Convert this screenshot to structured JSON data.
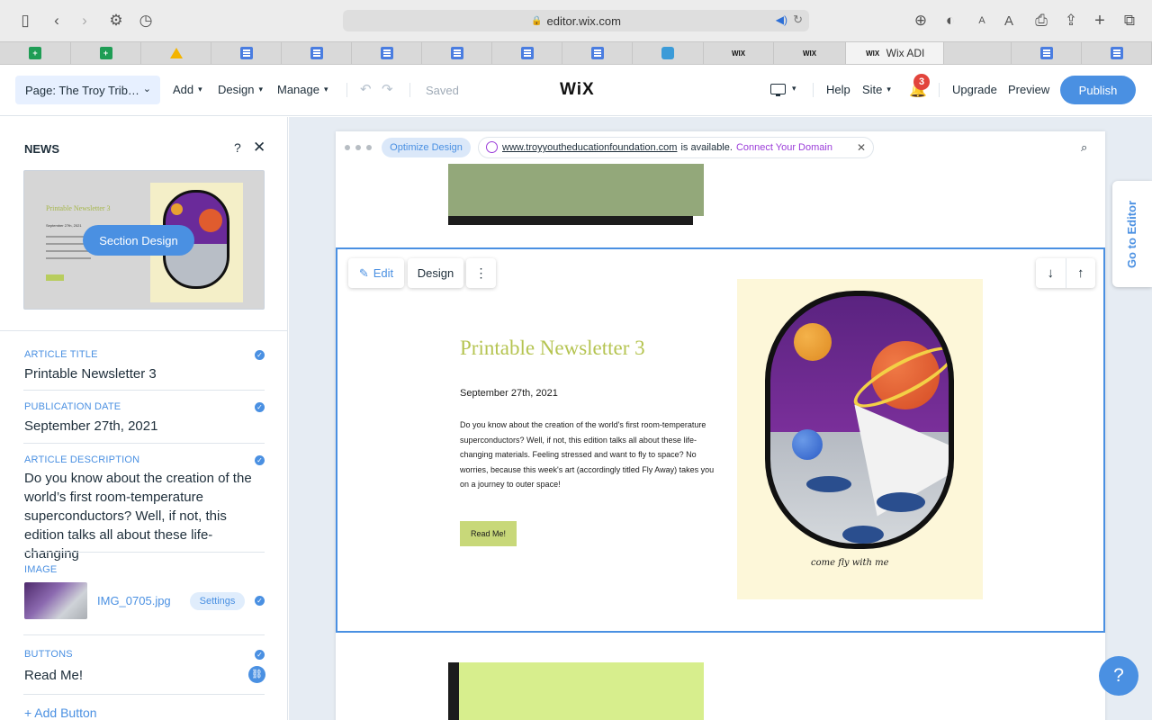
{
  "browser": {
    "url": "editor.wix.com",
    "tabs": [
      {
        "icon": "sheets-icon",
        "label": ""
      },
      {
        "icon": "sheets-icon",
        "label": ""
      },
      {
        "icon": "drive-icon",
        "label": ""
      },
      {
        "icon": "docs-icon",
        "label": ""
      },
      {
        "icon": "docs-icon",
        "label": ""
      },
      {
        "icon": "docs-icon",
        "label": ""
      },
      {
        "icon": "docs-icon",
        "label": ""
      },
      {
        "icon": "docs-icon",
        "label": ""
      },
      {
        "icon": "app-icon",
        "label": ""
      },
      {
        "icon": "wix-icon",
        "label": ""
      },
      {
        "icon": "wix-icon",
        "label": ""
      },
      {
        "icon": "wix-icon",
        "label": "Wix ADI"
      },
      {
        "icon": "docs-icon",
        "label": ""
      },
      {
        "icon": "docs-icon",
        "label": ""
      }
    ]
  },
  "editor": {
    "page_select": "Page: The Troy Trib…",
    "menu": {
      "add": "Add",
      "design": "Design",
      "manage": "Manage"
    },
    "saved": "Saved",
    "logo": "WiX",
    "help": "Help",
    "site": "Site",
    "notifications": "3",
    "upgrade": "Upgrade",
    "preview": "Preview",
    "publish": "Publish"
  },
  "panel": {
    "title": "NEWS",
    "help": "?",
    "section_design": "Section Design",
    "thumb": {
      "title": "Printable Newsletter 3",
      "date": "September 27th, 2021"
    },
    "fields": {
      "article_title_label": "ARTICLE TITLE",
      "article_title": "Printable Newsletter 3",
      "publication_date_label": "PUBLICATION DATE",
      "publication_date": "September 27th, 2021",
      "article_description_label": "ARTICLE DESCRIPTION",
      "article_description": "Do you know about the creation of the world’s first room-temperature superconductors? Well, if not, this edition talks all about these life-changing",
      "image_label": "IMAGE",
      "image_name": "IMG_0705.jpg",
      "image_settings": "Settings",
      "buttons_label": "BUTTONS",
      "button_text": "Read Me!",
      "add_button": "+  Add Button"
    }
  },
  "canvas": {
    "optimize": "Optimize Design",
    "domain_url": "www.troyyoutheducationfoundation.com",
    "domain_available": "is available.",
    "connect_domain": "Connect Your Domain",
    "edit": "Edit",
    "design": "Design",
    "newsletter_title": "Printable Newsletter 3",
    "newsletter_date": "September 27th, 2021",
    "newsletter_desc": "Do you know about the creation of the world's first room-temperature superconductors? Well, if not, this edition talks all about these life-changing materials. Feeling stressed and want to fly to space? No worries, because this week's art (accordingly titled Fly Away) takes you on a journey to outer space!",
    "read_me": "Read Me!",
    "art_caption": "come fly with me",
    "go_to_editor": "Go to Editor"
  },
  "colors": {
    "accent": "#4a90e2",
    "title_green": "#b5c451",
    "button_green": "#c8d879",
    "badge_red": "#e2443c",
    "connect_purple": "#9b3dd9"
  }
}
